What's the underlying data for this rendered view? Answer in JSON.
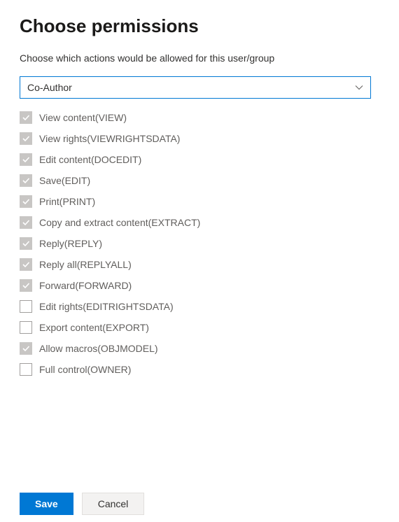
{
  "header": {
    "title": "Choose permissions",
    "subtitle": "Choose which actions would be allowed for this user/group"
  },
  "dropdown": {
    "selected": "Co-Author"
  },
  "permissions": [
    {
      "label": "View content(VIEW)",
      "checked": true
    },
    {
      "label": "View rights(VIEWRIGHTSDATA)",
      "checked": true
    },
    {
      "label": "Edit content(DOCEDIT)",
      "checked": true
    },
    {
      "label": "Save(EDIT)",
      "checked": true
    },
    {
      "label": "Print(PRINT)",
      "checked": true
    },
    {
      "label": "Copy and extract content(EXTRACT)",
      "checked": true
    },
    {
      "label": "Reply(REPLY)",
      "checked": true
    },
    {
      "label": "Reply all(REPLYALL)",
      "checked": true
    },
    {
      "label": "Forward(FORWARD)",
      "checked": true
    },
    {
      "label": "Edit rights(EDITRIGHTSDATA)",
      "checked": false
    },
    {
      "label": "Export content(EXPORT)",
      "checked": false
    },
    {
      "label": "Allow macros(OBJMODEL)",
      "checked": true
    },
    {
      "label": "Full control(OWNER)",
      "checked": false
    }
  ],
  "buttons": {
    "save": "Save",
    "cancel": "Cancel"
  }
}
